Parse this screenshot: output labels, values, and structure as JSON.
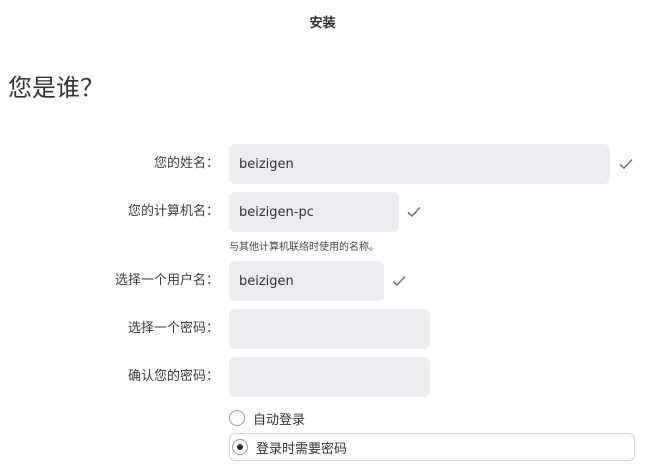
{
  "window": {
    "title": "安装"
  },
  "page": {
    "heading": "您是谁？"
  },
  "form": {
    "name": {
      "label": "您的姓名：",
      "value": "beizigen"
    },
    "computer": {
      "label": "您的计算机名：",
      "value": "beizigen-pc",
      "hint": "与其他计算机联络时使用的名称。"
    },
    "username": {
      "label": "选择一个用户名：",
      "value": "beizigen"
    },
    "password": {
      "label": "选择一个密码：",
      "value": ""
    },
    "confirm": {
      "label": "确认您的密码：",
      "value": ""
    },
    "login_options": [
      {
        "label": "自动登录",
        "selected": false
      },
      {
        "label": "登录时需要密码",
        "selected": true
      }
    ]
  },
  "colors": {
    "input_bg": "#ecebed",
    "check": "#7a7a7a"
  }
}
